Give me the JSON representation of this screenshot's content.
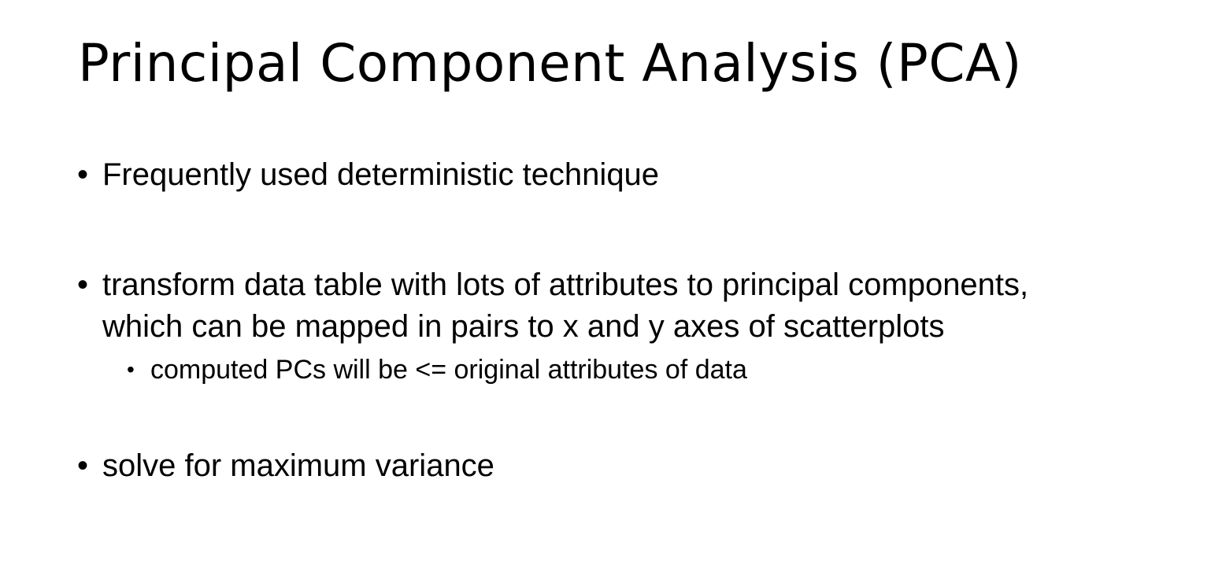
{
  "slide": {
    "title": "Principal Component Analysis (PCA)",
    "bullet_glyph": "•",
    "bullets": [
      {
        "level": 1,
        "lines": [
          "Frequently used deterministic technique"
        ]
      },
      {
        "level": 1,
        "lines": [
          "transform data table with lots of attributes to principal components,",
          "which can be mapped in pairs to x and y axes of scatterplots"
        ]
      },
      {
        "level": 2,
        "lines": [
          "computed PCs will be <= original attributes of data"
        ]
      },
      {
        "level": 1,
        "lines": [
          "solve for maximum variance"
        ]
      }
    ]
  }
}
